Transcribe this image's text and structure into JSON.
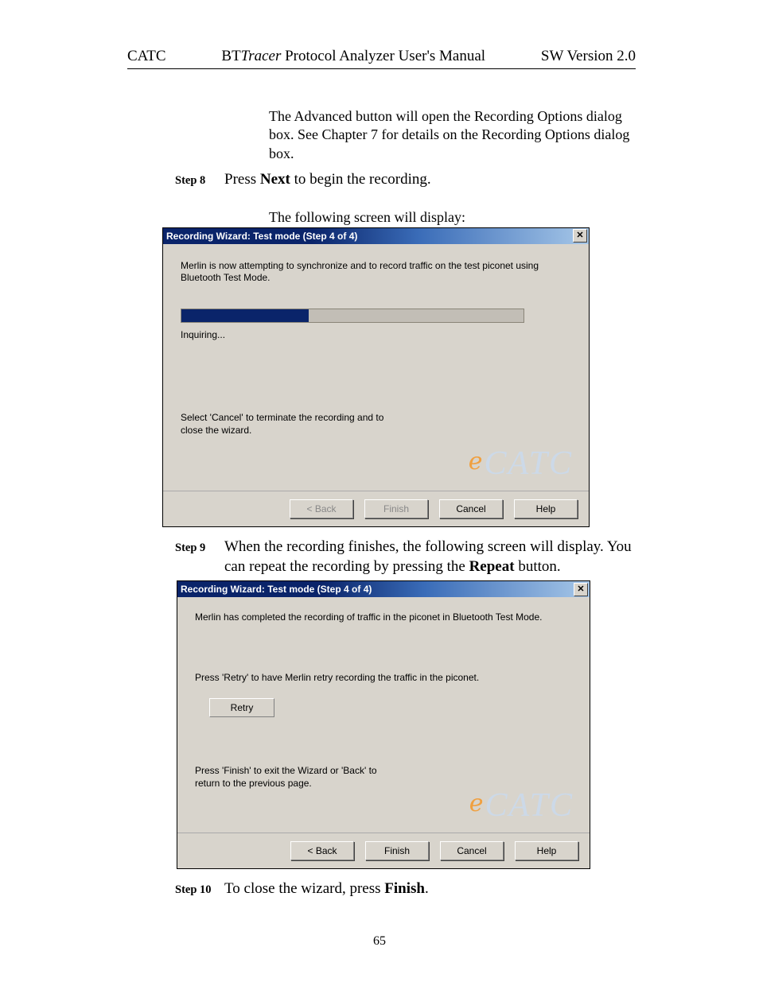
{
  "header": {
    "left": "CATC",
    "center_prefix": "BT",
    "center_italic": "Tracer",
    "center_suffix": " Protocol Analyzer User's Manual",
    "right": "SW Version 2.0"
  },
  "intro": "The Advanced button will open the Recording Options dialog box.  See Chapter 7 for details on the Recording Options dialog box.",
  "step8": {
    "label": "Step 8",
    "text_a": "Press ",
    "text_bold": "Next",
    "text_b": " to begin the recording."
  },
  "caption1": "The following screen will display:",
  "dialog1": {
    "title": "Recording Wizard: Test mode (Step 4 of 4)",
    "body": "Merlin is now attempting to synchronize and to record traffic on the test piconet using Bluetooth Test Mode.",
    "status": "Inquiring...",
    "hint": "Select 'Cancel' to terminate the recording and to close the wizard.",
    "logo": "CATC",
    "buttons": {
      "back": "< Back",
      "finish": "Finish",
      "cancel": "Cancel",
      "help": "Help"
    }
  },
  "step9": {
    "label": "Step 9",
    "text_a": "When the recording finishes, the following screen will display.  You can repeat the recording by pressing the ",
    "text_bold": "Repeat",
    "text_b": " button."
  },
  "dialog2": {
    "title": "Recording Wizard: Test mode (Step 4 of 4)",
    "body": "Merlin has completed the recording of traffic in the piconet in Bluetooth Test Mode.",
    "retry_hint": "Press 'Retry' to have Merlin retry recording the traffic in the piconet.",
    "retry": "Retry",
    "hint": "Press 'Finish' to exit the Wizard or 'Back' to return to the previous page.",
    "logo": "CATC",
    "buttons": {
      "back": "< Back",
      "finish": "Finish",
      "cancel": "Cancel",
      "help": "Help"
    }
  },
  "step10": {
    "label": "Step 10",
    "text_a": "To close the wizard, press ",
    "text_bold": "Finish",
    "text_b": "."
  },
  "page_number": "65"
}
